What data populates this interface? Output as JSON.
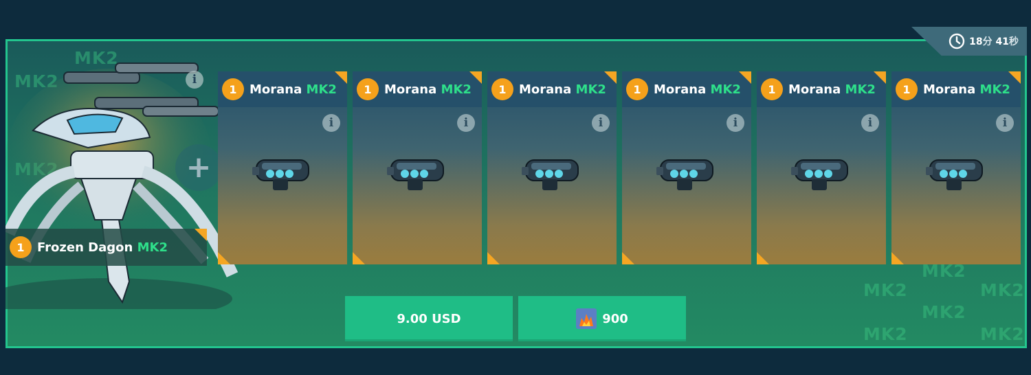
{
  "timer": {
    "hours": "18",
    "hours_unit": "分",
    "minutes": "41",
    "minutes_unit": "秒",
    "icon": "clock-icon"
  },
  "watermark_text": "MK2",
  "robot": {
    "quantity": "1",
    "name": "Frozen Dagon",
    "tier": "MK2",
    "info_icon": "i"
  },
  "plus_symbol": "+",
  "weapons": [
    {
      "quantity": "1",
      "name": "Morana",
      "tier": "MK2",
      "info_icon": "i"
    },
    {
      "quantity": "1",
      "name": "Morana",
      "tier": "MK2",
      "info_icon": "i"
    },
    {
      "quantity": "1",
      "name": "Morana",
      "tier": "MK2",
      "info_icon": "i"
    },
    {
      "quantity": "1",
      "name": "Morana",
      "tier": "MK2",
      "info_icon": "i"
    },
    {
      "quantity": "1",
      "name": "Morana",
      "tier": "MK2",
      "info_icon": "i"
    },
    {
      "quantity": "1",
      "name": "Morana",
      "tier": "MK2",
      "info_icon": "i"
    }
  ],
  "purchase": {
    "usd_label": "9.00 USD",
    "gold_amount": "900",
    "gold_icon": "gold-currency-icon"
  },
  "colors": {
    "accent_green": "#23c58e",
    "button_green": "#1fbd86",
    "tier_green": "#2ee08a",
    "badge_orange": "#f5a11b",
    "background": "#0d2b3d"
  }
}
